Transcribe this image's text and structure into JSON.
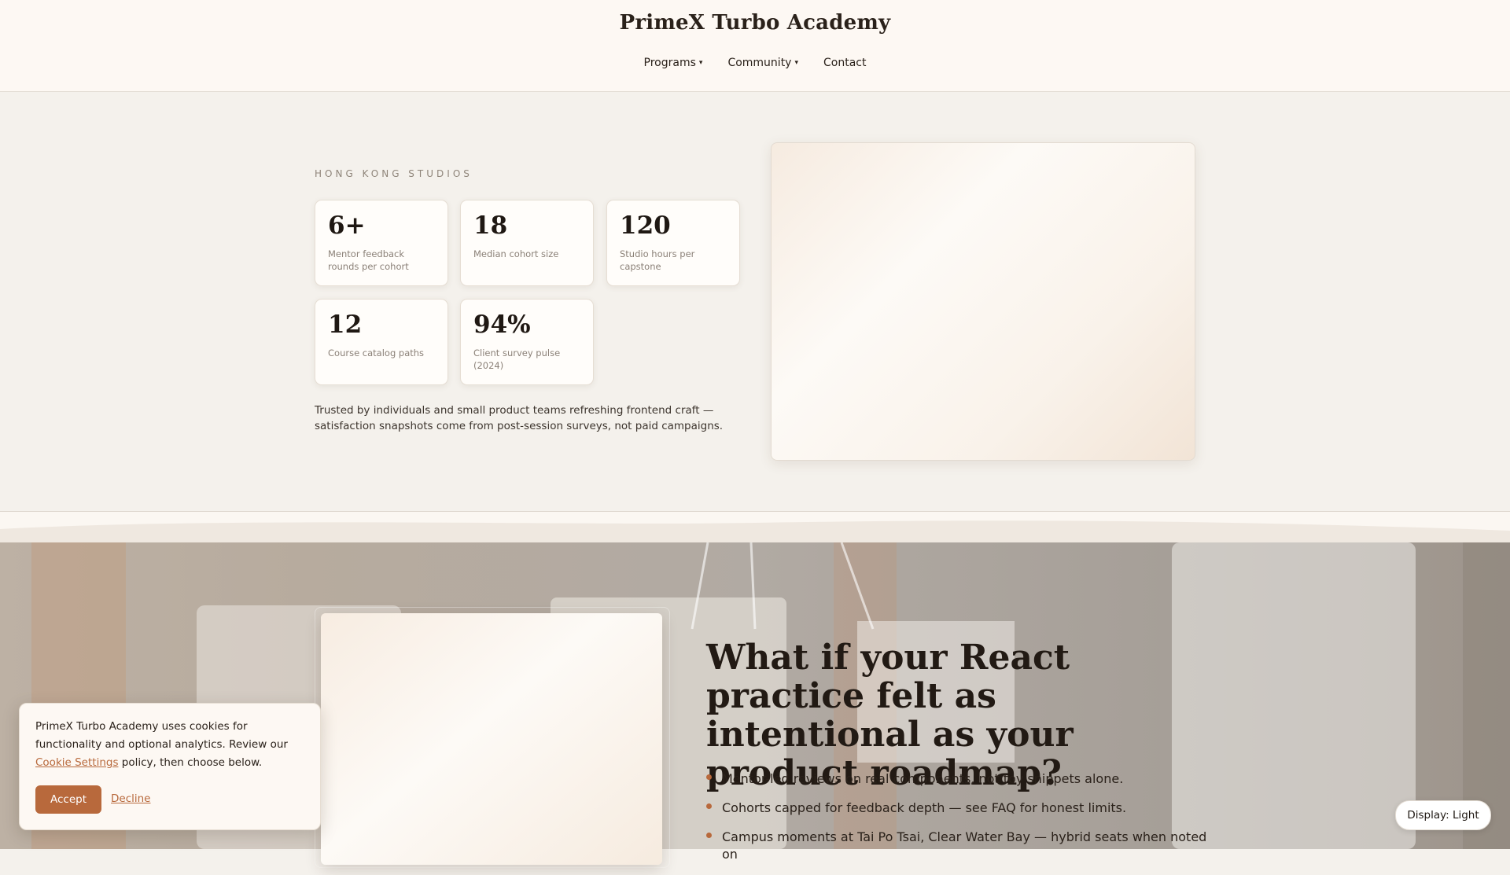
{
  "header": {
    "brand": "PrimeX Turbo Academy",
    "nav": [
      {
        "label": "Programs",
        "caret": "▾"
      },
      {
        "label": "Community",
        "caret": "▾"
      },
      {
        "label": "Contact"
      }
    ]
  },
  "hero": {
    "eyebrow": "HONG KONG STUDIOS",
    "stats": [
      {
        "value": "6+",
        "label": "Mentor feedback rounds per cohort"
      },
      {
        "value": "18",
        "label": "Median cohort size"
      },
      {
        "value": "120",
        "label": "Studio hours per capstone"
      },
      {
        "value": "12",
        "label": "Course catalog paths"
      },
      {
        "value": "94%",
        "label": "Client survey pulse (2024)"
      }
    ],
    "trust_text": "Trusted by individuals and small product teams refreshing frontend craft — satisfaction snapshots come from post-session surveys, not paid campaigns."
  },
  "feature": {
    "headline": "What if your React practice felt as intentional as your product roadmap?",
    "bullets": [
      "Mentor-led reviews on real components, not toy snippets alone.",
      "Cohorts capped for feedback depth — see FAQ for honest limits.",
      "Campus moments at Tai Po Tsai, Clear Water Bay — hybrid seats when noted on"
    ]
  },
  "cookie": {
    "text_before": "PrimeX Turbo Academy uses cookies for functionality and optional analytics. Review our ",
    "link_label": "Cookie Settings",
    "text_after": " policy, then choose below.",
    "accept_label": "Accept",
    "decline_label": "Decline"
  },
  "display_toggle": {
    "label": "Display: Light"
  },
  "colors": {
    "accent": "#b8693c",
    "header_bg": "#fdf8f3",
    "page_bg": "#f4f1ec",
    "text": "#2a211a"
  }
}
